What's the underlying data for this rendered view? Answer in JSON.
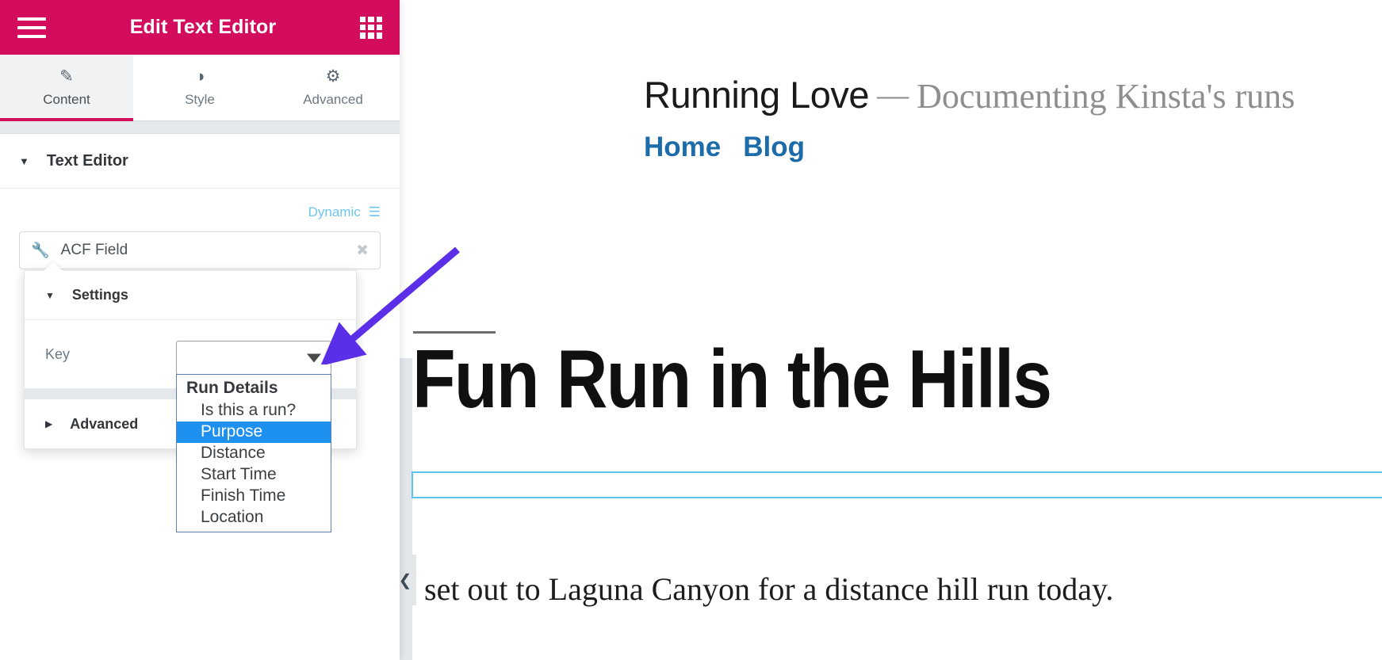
{
  "panel": {
    "header": {
      "title": "Edit Text Editor",
      "menu_icon": "hamburger-icon",
      "apps_icon": "grid-apps-icon"
    },
    "tabs": [
      {
        "label": "Content",
        "icon": "pencil-icon",
        "active": true
      },
      {
        "label": "Style",
        "icon": "contrast-icon",
        "active": false
      },
      {
        "label": "Advanced",
        "icon": "gear-icon",
        "active": false
      }
    ],
    "section": {
      "title": "Text Editor",
      "caret": "caret-down"
    },
    "dynamic": {
      "label": "Dynamic",
      "icon": "database-stack-icon"
    },
    "tag_field": {
      "icon": "wrench-icon",
      "value": "ACF Field",
      "clear_icon": "clear-circle-icon"
    }
  },
  "popover": {
    "settings_title": "Settings",
    "settings_caret": "caret-down",
    "key_label": "Key",
    "advanced_title": "Advanced",
    "advanced_caret": "caret-right"
  },
  "select": {
    "value": "",
    "optgroup_label": "Run Details",
    "options": [
      {
        "label": "Is this a run?",
        "selected": false
      },
      {
        "label": "Purpose",
        "selected": true
      },
      {
        "label": "Distance",
        "selected": false
      },
      {
        "label": "Start Time",
        "selected": false
      },
      {
        "label": "Finish Time",
        "selected": false
      },
      {
        "label": "Location",
        "selected": false
      }
    ]
  },
  "preview": {
    "site_title": "Running Love",
    "site_dash": "—",
    "site_tagline": "Documenting Kinsta's runs",
    "nav": [
      {
        "label": "Home"
      },
      {
        "label": "Blog"
      }
    ],
    "post_title": "Fun Run in the Hills",
    "post_body": "set out to Laguna Canyon for a distance hill run today.",
    "handle_icon": "chevron-left-icon"
  },
  "colors": {
    "brand_pink": "#d30c5d",
    "dynamic_blue": "#6ec6f0",
    "select_highlight": "#1e90f0",
    "nav_link": "#1b6ca8",
    "annotation_purple": "#5b2fe8",
    "widget_outline": "#59c3ec"
  }
}
